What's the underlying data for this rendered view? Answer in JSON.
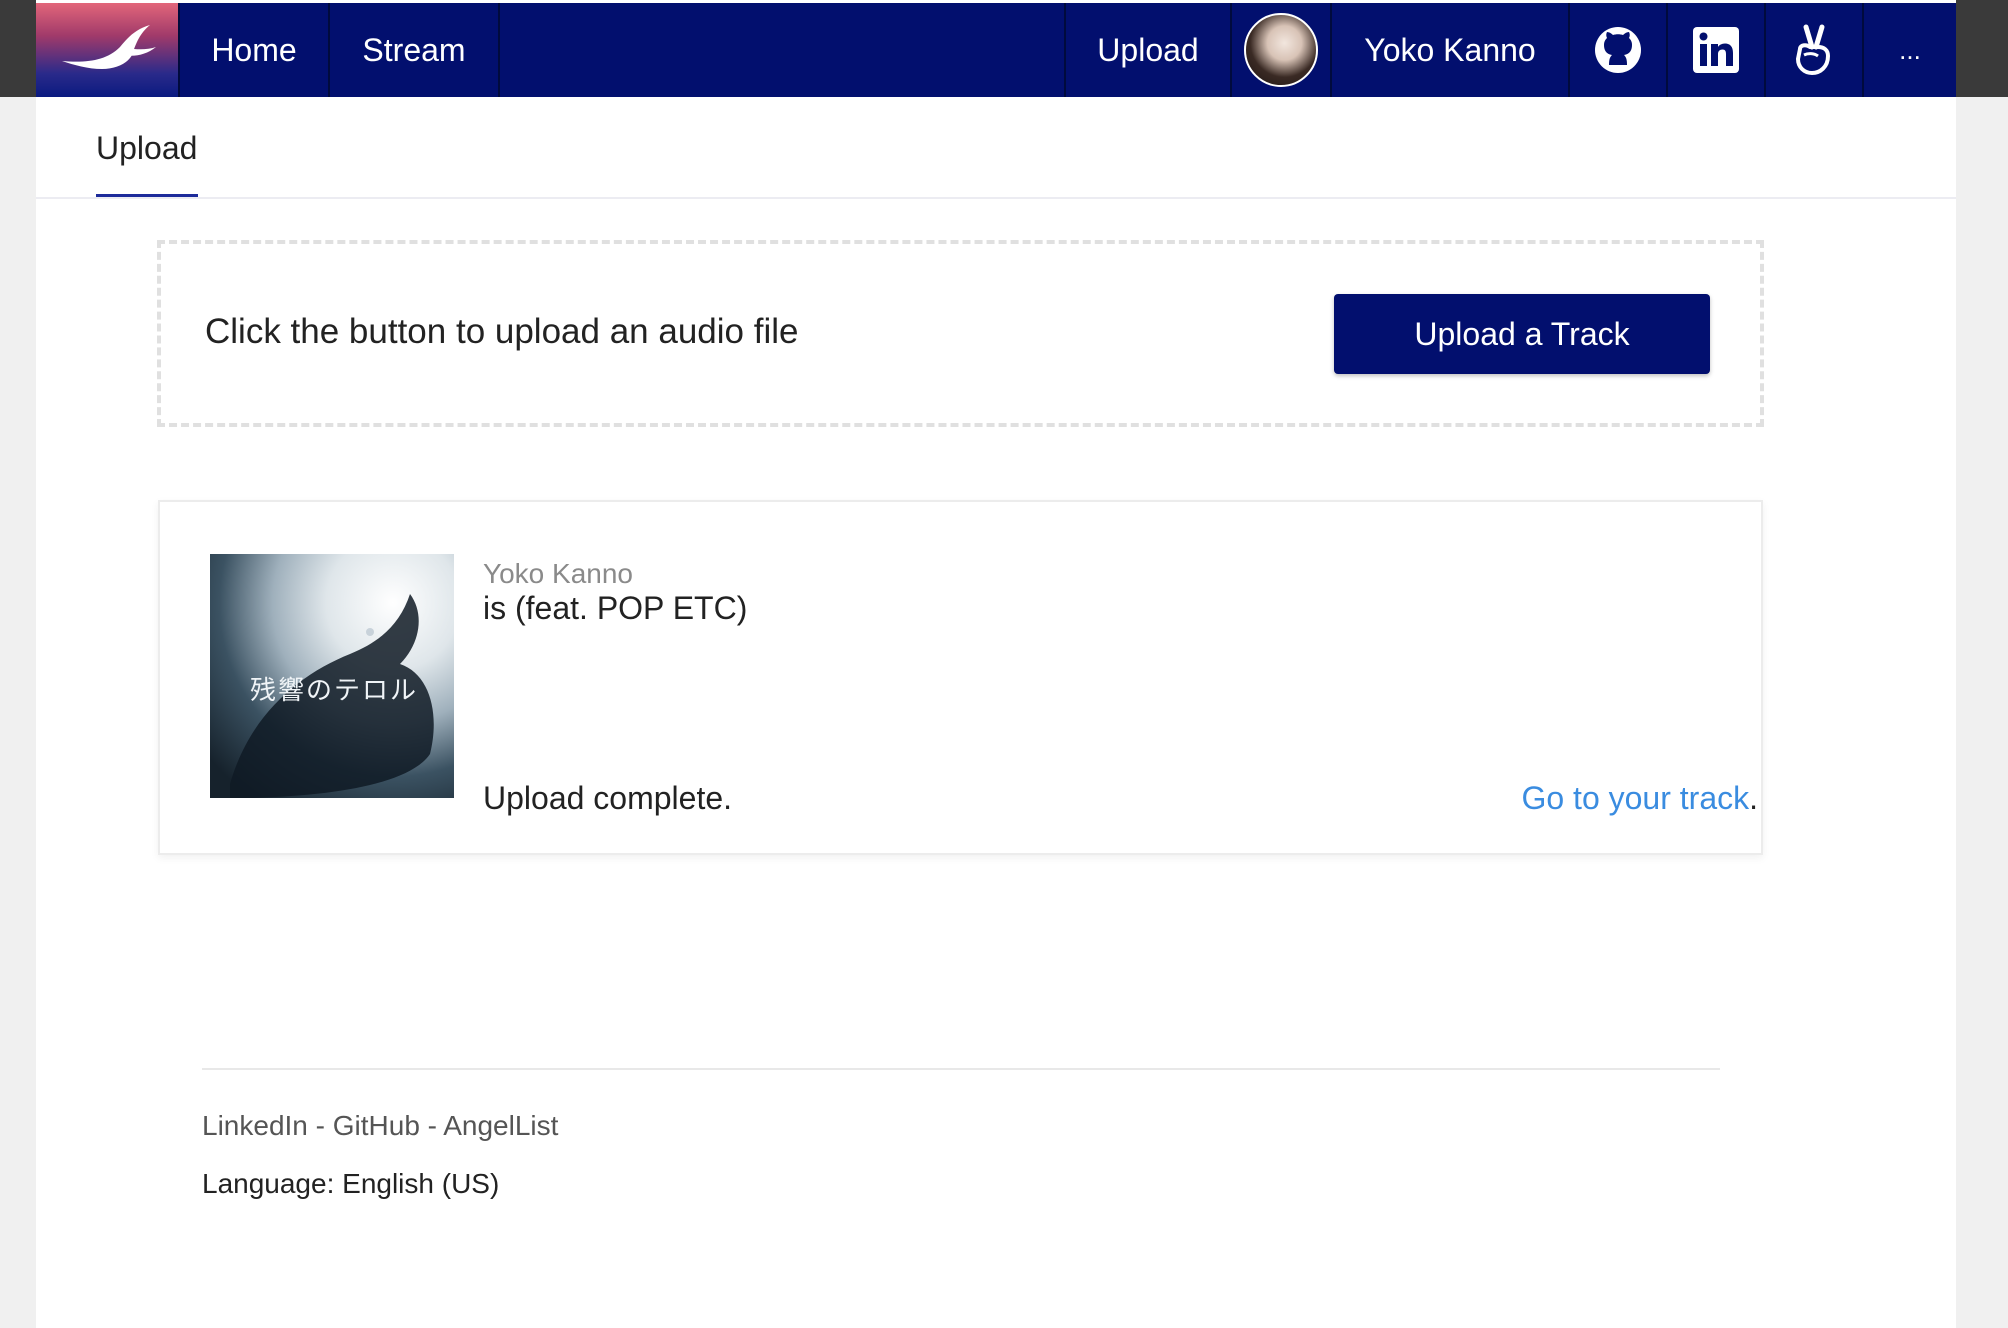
{
  "nav": {
    "home": "Home",
    "stream": "Stream",
    "upload": "Upload",
    "user_name": "Yoko Kanno",
    "more": "...",
    "icons": [
      "github-icon",
      "linkedin-icon",
      "angellist-icon"
    ]
  },
  "tabs": {
    "active": "Upload"
  },
  "dropzone": {
    "prompt": "Click the button to upload an audio file",
    "button_label": "Upload a Track"
  },
  "track": {
    "artist": "Yoko Kanno",
    "title": "is (feat. POP ETC)",
    "cover_text": "残響のテロル",
    "status": "Upload complete.",
    "link_text": "Go to your track",
    "link_suffix": "."
  },
  "footer": {
    "links": "LinkedIn - GitHub - AngelList",
    "language": "Language: English (US)"
  },
  "colors": {
    "nav_bg": "#020f6e",
    "link": "#3a8ce0",
    "button_bg": "#020f6e"
  }
}
